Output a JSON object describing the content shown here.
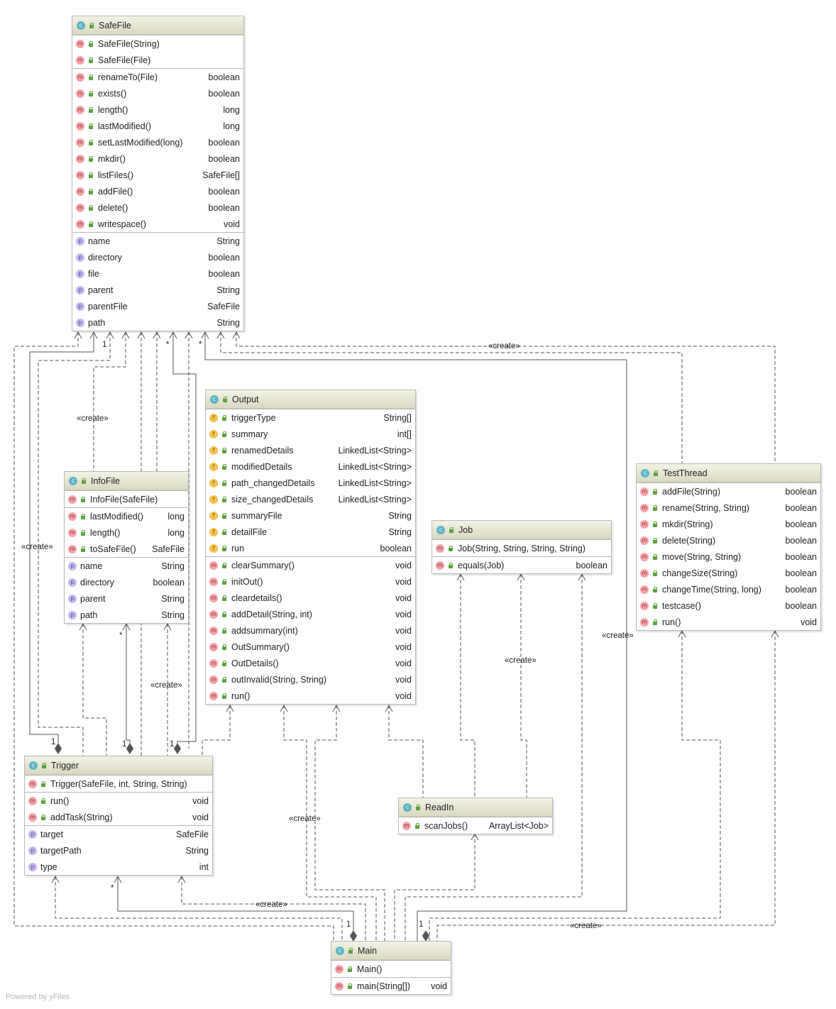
{
  "classes": {
    "SafeFile": {
      "name": "SafeFile",
      "constructors": [
        {
          "name": "SafeFile(String)"
        },
        {
          "name": "SafeFile(File)"
        }
      ],
      "methods": [
        {
          "name": "renameTo(File)",
          "type": "boolean"
        },
        {
          "name": "exists()",
          "type": "boolean"
        },
        {
          "name": "length()",
          "type": "long"
        },
        {
          "name": "lastModified()",
          "type": "long"
        },
        {
          "name": "setLastModified(long)",
          "type": "boolean"
        },
        {
          "name": "mkdir()",
          "type": "boolean"
        },
        {
          "name": "listFiles()",
          "type": "SafeFile[]"
        },
        {
          "name": "addFile()",
          "type": "boolean"
        },
        {
          "name": "delete()",
          "type": "boolean"
        },
        {
          "name": "writespace()",
          "type": "void"
        }
      ],
      "properties": [
        {
          "name": "name",
          "type": "String"
        },
        {
          "name": "directory",
          "type": "boolean"
        },
        {
          "name": "file",
          "type": "boolean"
        },
        {
          "name": "parent",
          "type": "String"
        },
        {
          "name": "parentFile",
          "type": "SafeFile"
        },
        {
          "name": "path",
          "type": "String"
        }
      ]
    },
    "InfoFile": {
      "name": "InfoFile",
      "constructors": [
        {
          "name": "InfoFile(SafeFile)"
        }
      ],
      "methods": [
        {
          "name": "lastModified()",
          "type": "long"
        },
        {
          "name": "length()",
          "type": "long"
        },
        {
          "name": "toSafeFile()",
          "type": "SafeFile"
        }
      ],
      "properties": [
        {
          "name": "name",
          "type": "String"
        },
        {
          "name": "directory",
          "type": "boolean"
        },
        {
          "name": "parent",
          "type": "String"
        },
        {
          "name": "path",
          "type": "String"
        }
      ]
    },
    "Output": {
      "name": "Output",
      "fields": [
        {
          "name": "triggerType",
          "type": "String[]"
        },
        {
          "name": "summary",
          "type": "int[]"
        },
        {
          "name": "renamedDetails",
          "type": "LinkedList<String>"
        },
        {
          "name": "modifiedDetails",
          "type": "LinkedList<String>"
        },
        {
          "name": "path_changedDetails",
          "type": "LinkedList<String>"
        },
        {
          "name": "size_changedDetails",
          "type": "LinkedList<String>"
        },
        {
          "name": "summaryFile",
          "type": "String"
        },
        {
          "name": "detailFile",
          "type": "String"
        },
        {
          "name": "run",
          "type": "boolean"
        }
      ],
      "methods": [
        {
          "name": "clearSummary()",
          "type": "void"
        },
        {
          "name": "initOut()",
          "type": "void"
        },
        {
          "name": "cleardetails()",
          "type": "void"
        },
        {
          "name": "addDetail(String, int)",
          "type": "void"
        },
        {
          "name": "addsummary(int)",
          "type": "void"
        },
        {
          "name": "OutSummary()",
          "type": "void"
        },
        {
          "name": "OutDetails()",
          "type": "void"
        },
        {
          "name": "outInvalid(String, String)",
          "type": "void"
        },
        {
          "name": "run()",
          "type": "void"
        }
      ]
    },
    "Job": {
      "name": "Job",
      "constructors": [
        {
          "name": "Job(String, String, String, String)"
        }
      ],
      "methods": [
        {
          "name": "equals(Job)",
          "type": "boolean"
        }
      ]
    },
    "TestThread": {
      "name": "TestThread",
      "methods": [
        {
          "name": "addFile(String)",
          "type": "boolean"
        },
        {
          "name": "rename(String, String)",
          "type": "boolean"
        },
        {
          "name": "mkdir(String)",
          "type": "boolean"
        },
        {
          "name": "delete(String)",
          "type": "boolean"
        },
        {
          "name": "move(String, String)",
          "type": "boolean"
        },
        {
          "name": "changeSize(String)",
          "type": "boolean"
        },
        {
          "name": "changeTime(String, long)",
          "type": "boolean"
        },
        {
          "name": "testcase()",
          "type": "boolean"
        },
        {
          "name": "run()",
          "type": "void"
        }
      ]
    },
    "Trigger": {
      "name": "Trigger",
      "constructors": [
        {
          "name": "Trigger(SafeFile, int, String, String)"
        }
      ],
      "methods": [
        {
          "name": "run()",
          "type": "void"
        },
        {
          "name": "addTask(String)",
          "type": "void"
        }
      ],
      "properties": [
        {
          "name": "target",
          "type": "SafeFile"
        },
        {
          "name": "targetPath",
          "type": "String"
        },
        {
          "name": "type",
          "type": "int"
        }
      ]
    },
    "ReadIn": {
      "name": "ReadIn",
      "methods": [
        {
          "name": "scanJobs()",
          "type": "ArrayList<Job>"
        }
      ]
    },
    "Main": {
      "name": "Main",
      "constructors": [
        {
          "name": "Main()"
        }
      ],
      "methods": [
        {
          "name": "main(String[])",
          "type": "void"
        }
      ]
    }
  },
  "edge_labels": {
    "create": "«create»",
    "one": "1",
    "many": "*"
  },
  "badges": {
    "class": "c",
    "method": "m",
    "property": "p",
    "field": "f"
  },
  "watermark": "Powered by yFiles",
  "colors": {
    "edge": "#555555",
    "header_top": "#f3f3e4",
    "header_bottom": "#dadac2",
    "class_badge": "#5cb5c7",
    "method_badge": "#f3a5ab",
    "property_badge": "#c5b7ec",
    "field_badge": "#f3c24e"
  }
}
